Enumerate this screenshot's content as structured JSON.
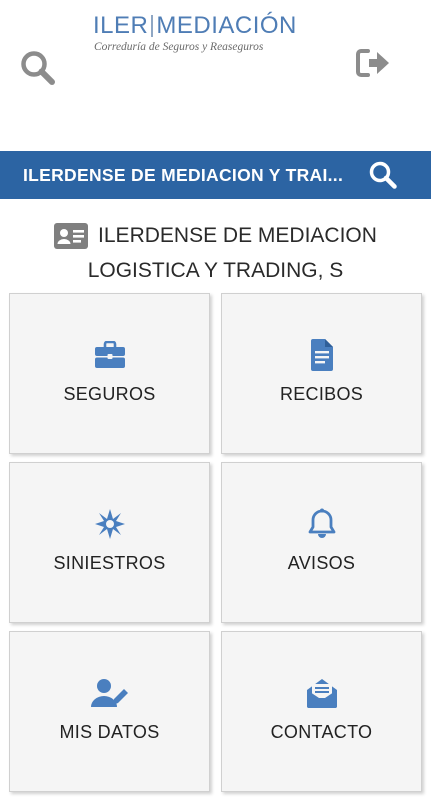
{
  "header": {
    "logo_iler": "ILER",
    "logo_mediacion": "MEDIACIÓN",
    "logo_tagline": "Correduría de Seguros y Reaseguros",
    "search_icon": "search-icon",
    "logout_icon": "sign-out-icon"
  },
  "search_bar": {
    "text": "ILERDENSE DE MEDIACION Y TRAI...",
    "icon": "search-icon"
  },
  "client": {
    "icon": "id-card-icon",
    "name_line1": "ILERDENSE DE MEDIACION",
    "name_line2": "LOGISTICA Y TRADING, S"
  },
  "menu": {
    "tiles": [
      {
        "label": "SEGUROS",
        "icon": "briefcase-icon"
      },
      {
        "label": "RECIBOS",
        "icon": "document-icon"
      },
      {
        "label": "SINIESTROS",
        "icon": "burst-icon"
      },
      {
        "label": "AVISOS",
        "icon": "bell-icon"
      },
      {
        "label": "MIS DATOS",
        "icon": "user-edit-icon"
      },
      {
        "label": "CONTACTO",
        "icon": "envelope-open-icon"
      }
    ]
  },
  "colors": {
    "brand_blue": "#2c64a3",
    "icon_blue": "#4a7fbf",
    "header_icon_gray": "#8c8c8c",
    "tile_background": "#f5f5f5"
  }
}
